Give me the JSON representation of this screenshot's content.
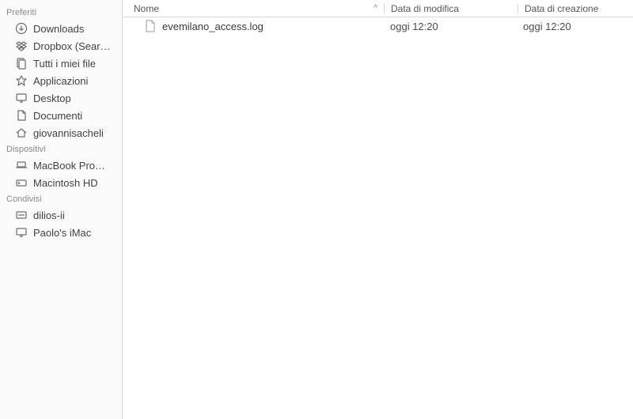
{
  "sidebar": {
    "sections": [
      {
        "header": "Preferiti",
        "items": [
          {
            "label": "Downloads",
            "icon": "download-icon"
          },
          {
            "label": "Dropbox (Sear…",
            "icon": "dropbox-icon"
          },
          {
            "label": "Tutti i miei file",
            "icon": "all-files-icon"
          },
          {
            "label": "Applicazioni",
            "icon": "applications-icon"
          },
          {
            "label": "Desktop",
            "icon": "desktop-icon"
          },
          {
            "label": "Documenti",
            "icon": "documents-icon"
          },
          {
            "label": "giovannisacheli",
            "icon": "home-icon"
          }
        ]
      },
      {
        "header": "Dispositivi",
        "items": [
          {
            "label": "MacBook Pro…",
            "icon": "laptop-icon"
          },
          {
            "label": "Macintosh HD",
            "icon": "disk-icon"
          }
        ]
      },
      {
        "header": "Condivisi",
        "items": [
          {
            "label": "dilios-ii",
            "icon": "server-icon"
          },
          {
            "label": "Paolo's iMac",
            "icon": "imac-icon"
          }
        ]
      }
    ]
  },
  "columns": {
    "name": "Nome",
    "modified": "Data di modifica",
    "created": "Data di creazione",
    "sort_indicator": "^"
  },
  "files": [
    {
      "name": "evemilano_access.log",
      "modified": "oggi 12:20",
      "created": "oggi 12:20"
    }
  ]
}
